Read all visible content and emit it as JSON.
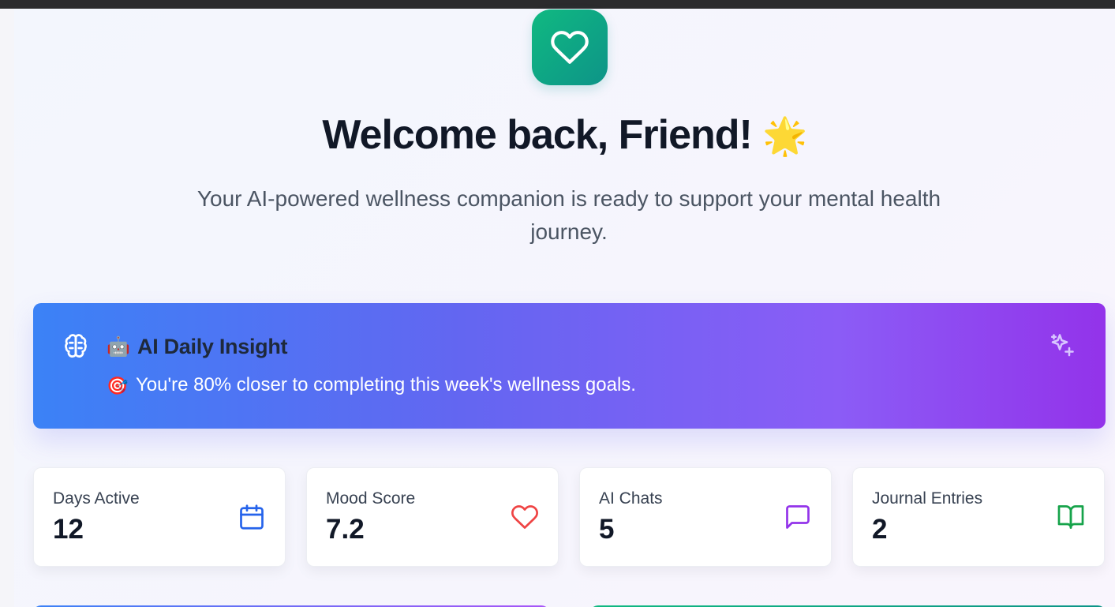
{
  "hero": {
    "icon": "heart-icon",
    "title": "Welcome back, Friend!",
    "title_emoji": "🌟",
    "subtitle": "Your AI-powered wellness companion is ready to support your mental health journey."
  },
  "insight": {
    "icon": "brain-icon",
    "heading_emoji": "🤖",
    "heading": "AI Daily Insight",
    "message_emoji": "🎯",
    "message": "You're 80% closer to completing this week's wellness goals.",
    "accent_icon": "sparkles-icon",
    "gradient": [
      "#3b82f6",
      "#9333ea"
    ]
  },
  "stats": [
    {
      "label": "Days Active",
      "value": "12",
      "icon": "calendar-icon",
      "color": "#2563eb"
    },
    {
      "label": "Mood Score",
      "value": "7.2",
      "icon": "heart-icon",
      "color": "#ef4444"
    },
    {
      "label": "AI Chats",
      "value": "5",
      "icon": "message-square-icon",
      "color": "#9333ea"
    },
    {
      "label": "Journal Entries",
      "value": "2",
      "icon": "book-open-icon",
      "color": "#16a34a"
    }
  ],
  "colors": {
    "brand": "#10b981",
    "text_primary": "#111827",
    "text_secondary": "#4b5563"
  }
}
